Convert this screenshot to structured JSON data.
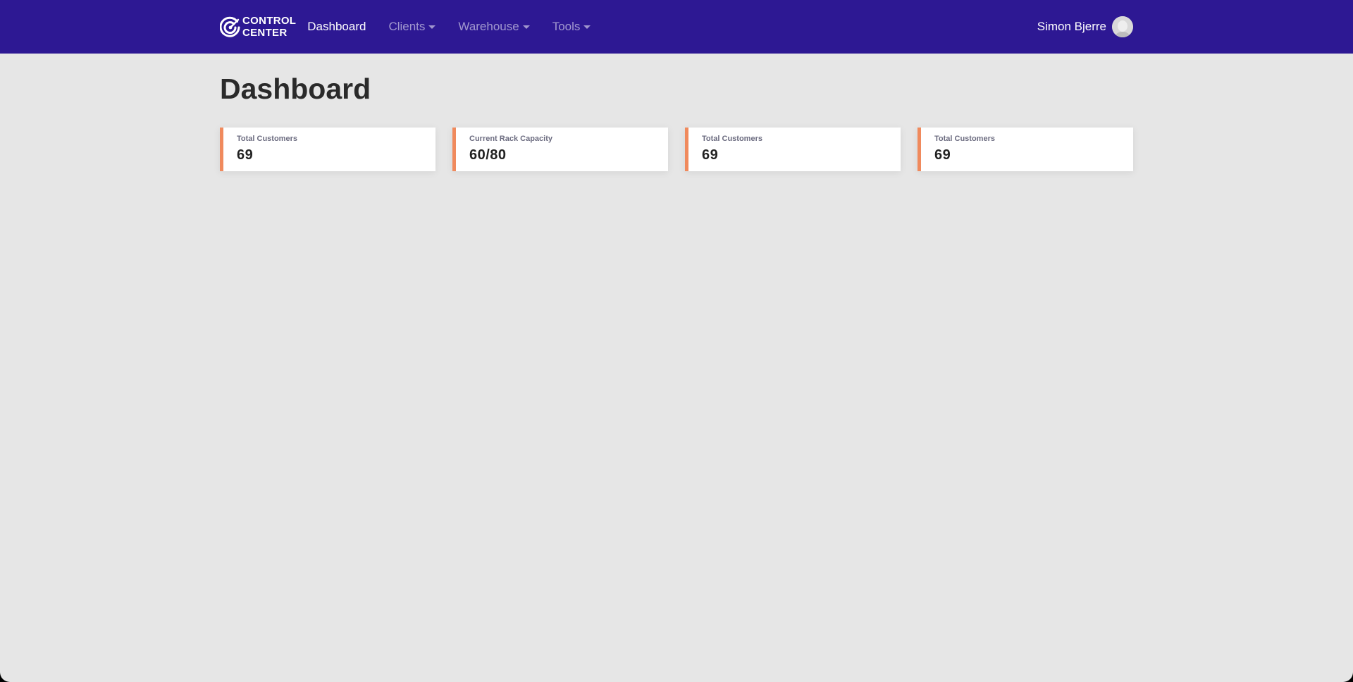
{
  "brand": {
    "line1": "CONTROL",
    "line2": "CENTER",
    "logo_icon": "target-c-logo-icon"
  },
  "nav": {
    "items": [
      {
        "label": "Dashboard",
        "active": true,
        "dropdown": false
      },
      {
        "label": "Clients",
        "active": false,
        "dropdown": true
      },
      {
        "label": "Warehouse",
        "active": false,
        "dropdown": true
      },
      {
        "label": "Tools",
        "active": false,
        "dropdown": true
      }
    ]
  },
  "user": {
    "name": "Simon Bjerre",
    "avatar_icon": "user-avatar-icon"
  },
  "page": {
    "title": "Dashboard"
  },
  "cards": [
    {
      "label": "Total Customers",
      "value": "69"
    },
    {
      "label": "Current Rack Capacity",
      "value": "60/80"
    },
    {
      "label": "Total Customers",
      "value": "69"
    },
    {
      "label": "Total Customers",
      "value": "69"
    }
  ],
  "colors": {
    "navbar": "#2d1893",
    "accent": "#f08a5d",
    "background": "#e6e6e6"
  }
}
